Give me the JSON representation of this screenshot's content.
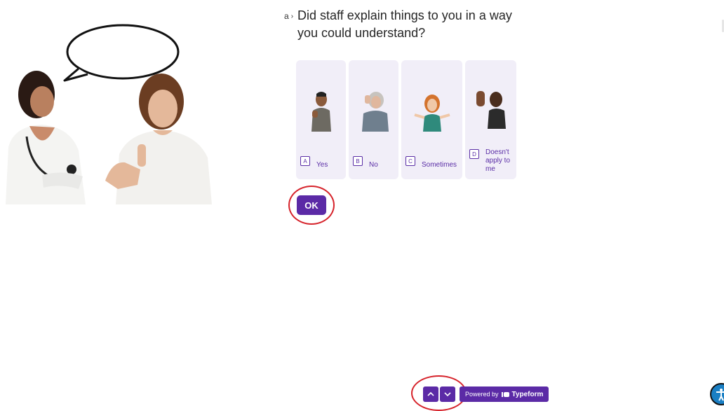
{
  "question": {
    "index": "a",
    "title": "Did staff explain things to you in a way you could understand?"
  },
  "choices": [
    {
      "key": "A",
      "label": "Yes",
      "image": "thumbs-up-man-image"
    },
    {
      "key": "B",
      "label": "No",
      "image": "thumbs-down-woman-image"
    },
    {
      "key": "C",
      "label": "Sometimes",
      "image": "shrugging-woman-image"
    },
    {
      "key": "D",
      "label": "Doesn't apply to me",
      "image": "stop-hand-man-image"
    }
  ],
  "ok_button": {
    "label": "OK"
  },
  "footer": {
    "powered_prefix": "Powered by",
    "brand": "Typeform",
    "up_icon": "chevron-up-icon",
    "down_icon": "chevron-down-icon"
  },
  "accessibility": {
    "icon": "accessibility-icon"
  },
  "colors": {
    "accent": "#5b2aa6",
    "choice_bg": "#f1eef8",
    "highlight": "#d6222a"
  }
}
